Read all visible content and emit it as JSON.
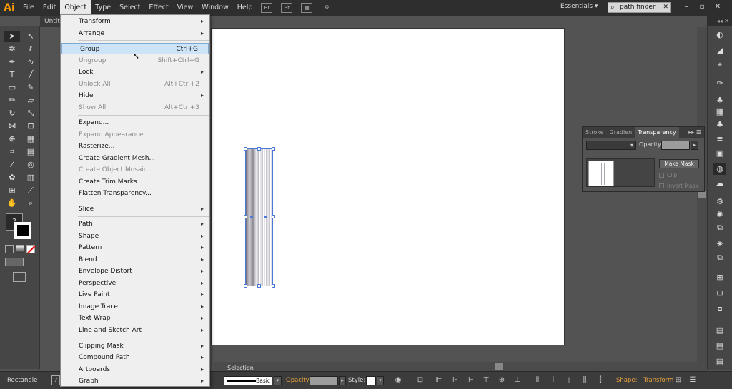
{
  "app": {
    "logo": "Ai",
    "document_tab": "Untitl"
  },
  "menubar": {
    "items": [
      "File",
      "Edit",
      "Object",
      "Type",
      "Select",
      "Effect",
      "View",
      "Window",
      "Help"
    ],
    "bridge_icon": "Br",
    "stock_icon": "St",
    "workspace": "Essentials",
    "search_value": "path finder"
  },
  "object_menu": {
    "items": [
      {
        "label": "Transform"
      },
      {
        "label": "Arrange"
      },
      {
        "label": "Group",
        "shortcut": "Ctrl+G"
      },
      {
        "label": "Ungroup",
        "shortcut": "Shift+Ctrl+G"
      },
      {
        "label": "Lock"
      },
      {
        "label": "Unlock All",
        "shortcut": "Alt+Ctrl+2"
      },
      {
        "label": "Hide"
      },
      {
        "label": "Show All",
        "shortcut": "Alt+Ctrl+3"
      },
      {
        "label": "Expand..."
      },
      {
        "label": "Expand Appearance"
      },
      {
        "label": "Rasterize..."
      },
      {
        "label": "Create Gradient Mesh..."
      },
      {
        "label": "Create Object Mosaic..."
      },
      {
        "label": "Create Trim Marks"
      },
      {
        "label": "Flatten Transparency..."
      },
      {
        "label": "Slice"
      },
      {
        "label": "Path"
      },
      {
        "label": "Shape"
      },
      {
        "label": "Pattern"
      },
      {
        "label": "Blend"
      },
      {
        "label": "Envelope Distort"
      },
      {
        "label": "Perspective"
      },
      {
        "label": "Live Paint"
      },
      {
        "label": "Image Trace"
      },
      {
        "label": "Text Wrap"
      },
      {
        "label": "Line and Sketch Art"
      },
      {
        "label": "Clipping Mask"
      },
      {
        "label": "Compound Path"
      },
      {
        "label": "Artboards"
      },
      {
        "label": "Graph"
      }
    ]
  },
  "transparency_panel": {
    "tabs": [
      "Stroke",
      "Gradien",
      "Transparency"
    ],
    "opacity_label": "Opacity:",
    "make_mask": "Make Mask",
    "clip": "Clip",
    "invert_mask": "Invert Mask"
  },
  "toolbar": {
    "fill_icon": "?"
  },
  "status": {
    "selection_tab": "Selection"
  },
  "control_bar": {
    "object_type": "Rectangle",
    "help_icon": "?",
    "stroke_profile": "Basic",
    "opacity_label": "Opacity:",
    "style_label": "Style:",
    "shape_label": "Shape:",
    "transform_label": "Transform"
  },
  "colors": {
    "accent_orange": "#e8a33d",
    "menu_hover": "#cde3f7",
    "selection_blue": "#4a7ad6"
  }
}
